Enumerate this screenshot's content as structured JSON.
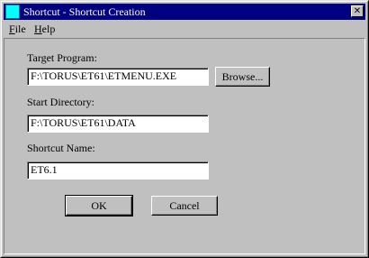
{
  "window": {
    "title": "Shortcut - Shortcut Creation",
    "close_glyph": "✕"
  },
  "menu": {
    "items": [
      {
        "label": "File"
      },
      {
        "label": "Help"
      }
    ]
  },
  "form": {
    "target_program": {
      "label": "Target Program:",
      "value": "F:\\TORUS\\ET61\\ETMENU.EXE"
    },
    "start_directory": {
      "label": "Start Directory:",
      "value": "F:\\TORUS\\ET61\\DATA"
    },
    "shortcut_name": {
      "label": "Shortcut Name:",
      "value": "ET6.1"
    },
    "browse_label": "Browse..."
  },
  "buttons": {
    "ok_label": "OK",
    "cancel_label": "Cancel"
  },
  "icons": {
    "app": "shortcut-app-icon",
    "close": "close-icon"
  },
  "colors": {
    "titlebar": "#000080",
    "face": "#c0c0c0",
    "app_icon": "#00ffff"
  }
}
